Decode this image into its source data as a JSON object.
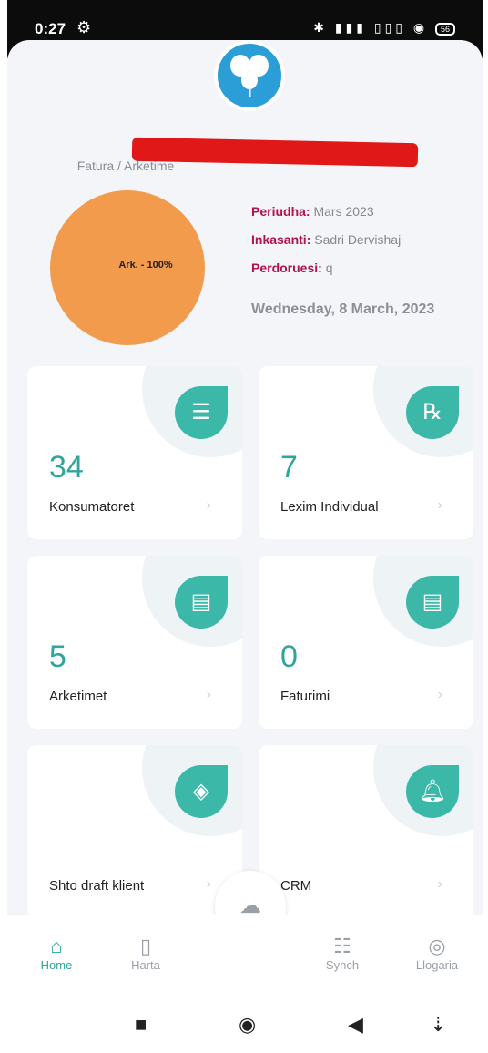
{
  "status_bar": {
    "time": "0:27",
    "battery": "56"
  },
  "header": {
    "pie_title": "Fatura / Arketime",
    "pie_label": "Ark. - 100%"
  },
  "info": {
    "periudha_label": "Periudha:",
    "periudha_value": "Mars 2023",
    "inkasanti_label": "Inkasanti:",
    "inkasanti_value": "Sadri Dervishaj",
    "perdoruesi_label": "Perdoruesi:",
    "perdoruesi_value": "q",
    "date": "Wednesday, 8 March, 2023"
  },
  "cards": [
    {
      "number": "34",
      "label": "Konsumatoret",
      "icon": "list-icon"
    },
    {
      "number": "7",
      "label": "Lexim Individual",
      "icon": "prescription-icon"
    },
    {
      "number": "5",
      "label": "Arketimet",
      "icon": "document-icon"
    },
    {
      "number": "0",
      "label": "Faturimi",
      "icon": "document-icon"
    },
    {
      "number": "",
      "label": "Shto draft klient",
      "icon": "add-layer-icon"
    },
    {
      "number": "",
      "label": "CRM",
      "icon": "bell-icon"
    }
  ],
  "nav": [
    {
      "label": "Home",
      "icon": "home-icon"
    },
    {
      "label": "Harta",
      "icon": "map-icon"
    },
    {
      "label": "Synch",
      "icon": "checklist-icon"
    },
    {
      "label": "Llogaria",
      "icon": "account-icon"
    }
  ],
  "colors": {
    "accent": "#2fa69c",
    "pie": "#f29b4c",
    "label_accent": "#b3124f",
    "logo": "#2b9ed8"
  }
}
